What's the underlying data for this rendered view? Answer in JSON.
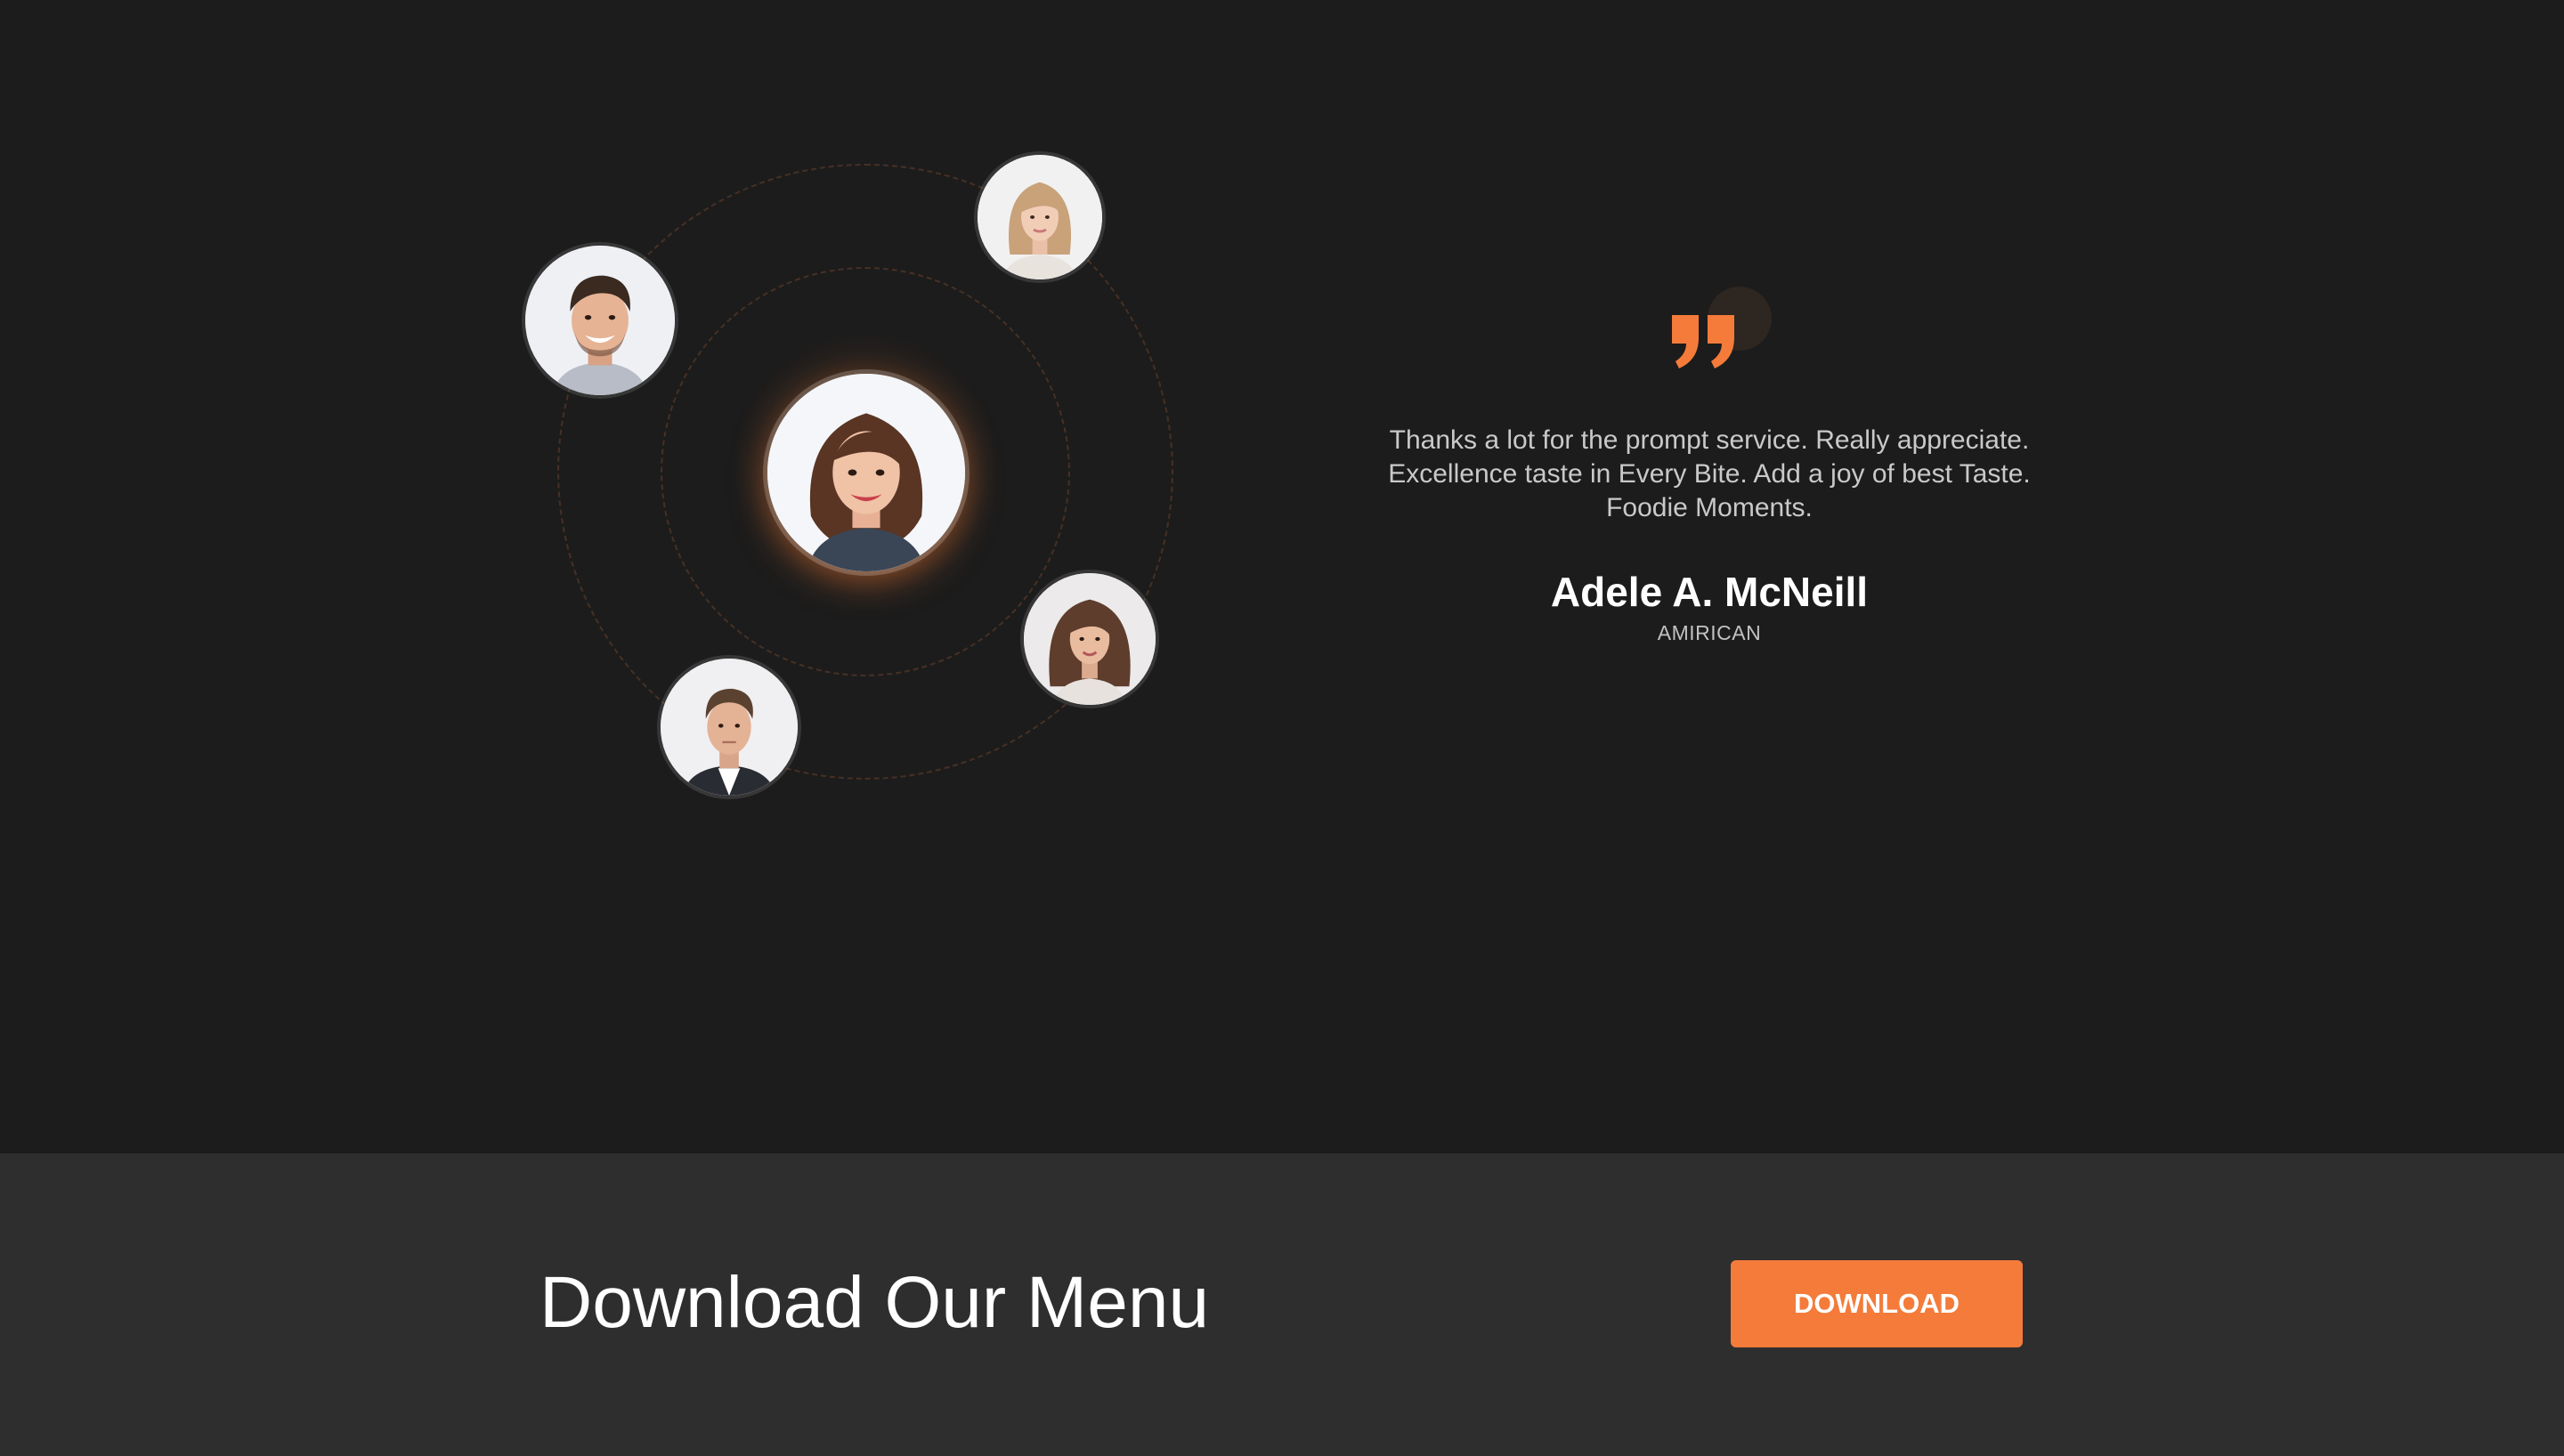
{
  "testimonial": {
    "quote_icon": "quote-icon",
    "quote_text": "Thanks a lot for the prompt service. Really appreciate. Excellence taste in Every Bite. Add a joy of best Taste. Foodie Moments.",
    "author_name": "Adele A. McNeill",
    "author_origin": "AMIRICAN",
    "avatars": [
      {
        "name": "avatar-main-woman"
      },
      {
        "name": "avatar-man-top-left"
      },
      {
        "name": "avatar-woman-top-right"
      },
      {
        "name": "avatar-woman-right"
      },
      {
        "name": "avatar-man-bottom"
      }
    ]
  },
  "download": {
    "title": "Download Our Menu",
    "button_label": "DOWNLOAD"
  },
  "colors": {
    "accent": "#f47b3a",
    "background": "#1c1c1c",
    "band_background": "#2f2e2f"
  }
}
